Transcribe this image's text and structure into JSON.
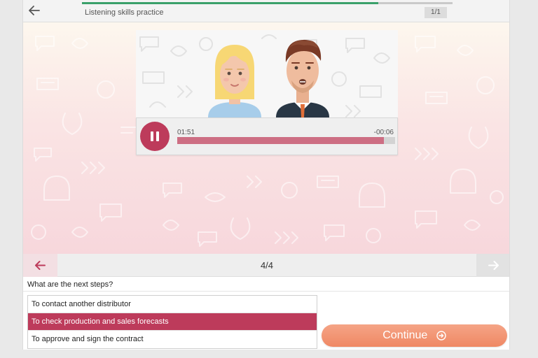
{
  "header": {
    "title": "Listening skills practice",
    "page_indicator": "1/1",
    "progress": 0.8,
    "back_icon": "arrow-left-icon"
  },
  "player": {
    "state": "playing",
    "elapsed": "01:51",
    "remaining": "-00:06",
    "progress": 0.95,
    "button_icon": "pause-icon"
  },
  "nav": {
    "counter": "4/4",
    "prev_icon": "arrow-left-icon",
    "next_icon": "arrow-right-icon"
  },
  "question": {
    "text": "What are the next steps?",
    "options": [
      "To contact another distributor",
      "To check production and sales forecasts",
      "To approve and sign the contract"
    ],
    "selected_index": 1
  },
  "continue": {
    "label": "Continue",
    "icon": "arrow-circle-right-icon"
  },
  "colors": {
    "accent": "#bd3b5b",
    "seek_fill": "#cd6e83",
    "progress_green": "#3aa06a",
    "continue": "#ef8864"
  }
}
